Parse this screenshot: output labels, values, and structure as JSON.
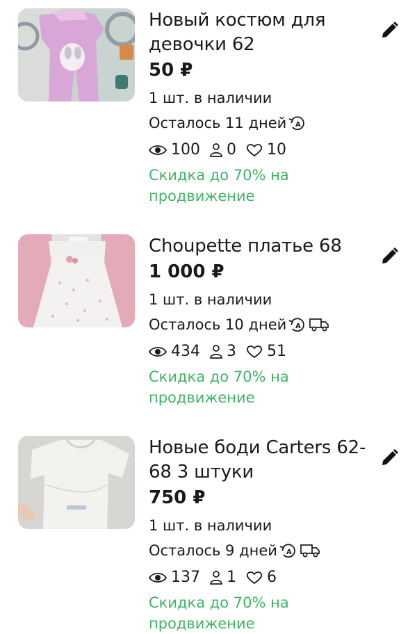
{
  "listings": [
    {
      "title": "Новый костюм для девочки 62",
      "price": "50 ₽",
      "stock": "1 шт. в наличии",
      "remaining": "Осталось 11 дней",
      "delivery": false,
      "views": "100",
      "contacts": "0",
      "favorites": "10",
      "promo": "Скидка до 70% на продвижение"
    },
    {
      "title": "Choupette платье 68",
      "price": "1 000 ₽",
      "stock": "1 шт. в наличии",
      "remaining": "Осталось 10 дней",
      "delivery": true,
      "views": "434",
      "contacts": "3",
      "favorites": "51",
      "promo": "Скидка до 70% на продвижение"
    },
    {
      "title": "Новые боди Carters 62-68 3 штуки",
      "price": "750 ₽",
      "stock": "1 шт. в наличии",
      "remaining": "Осталось 9 дней",
      "delivery": true,
      "views": "137",
      "contacts": "1",
      "favorites": "6",
      "promo": "Скидка до 70% на продвижение"
    }
  ],
  "colors": {
    "promo": "#3db564",
    "text": "#1a1a1a"
  },
  "icons": [
    "pencil-icon",
    "eye-icon",
    "person-icon",
    "heart-icon",
    "auto-renew-icon",
    "truck-icon"
  ]
}
